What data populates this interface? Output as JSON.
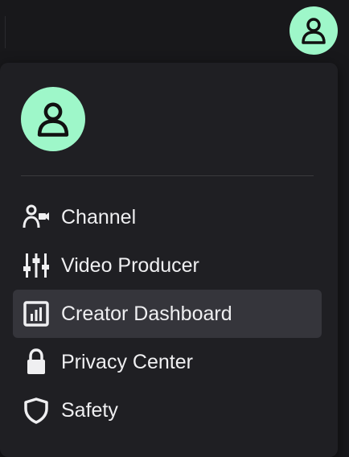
{
  "colors": {
    "avatar_bg": "#9ef7c9",
    "avatar_fg": "#111111",
    "menu_bg": "#1f1f23",
    "active_bg": "#35353b",
    "text": "#efeff1"
  },
  "topbar": {
    "avatar_icon": "user-icon"
  },
  "menu": {
    "avatar_icon": "user-icon",
    "items": [
      {
        "label": "Channel",
        "icon": "channel-icon",
        "active": false
      },
      {
        "label": "Video Producer",
        "icon": "sliders-icon",
        "active": false
      },
      {
        "label": "Creator Dashboard",
        "icon": "dashboard-icon",
        "active": true
      },
      {
        "label": "Privacy Center",
        "icon": "lock-icon",
        "active": false
      },
      {
        "label": "Safety",
        "icon": "shield-icon",
        "active": false
      }
    ]
  }
}
